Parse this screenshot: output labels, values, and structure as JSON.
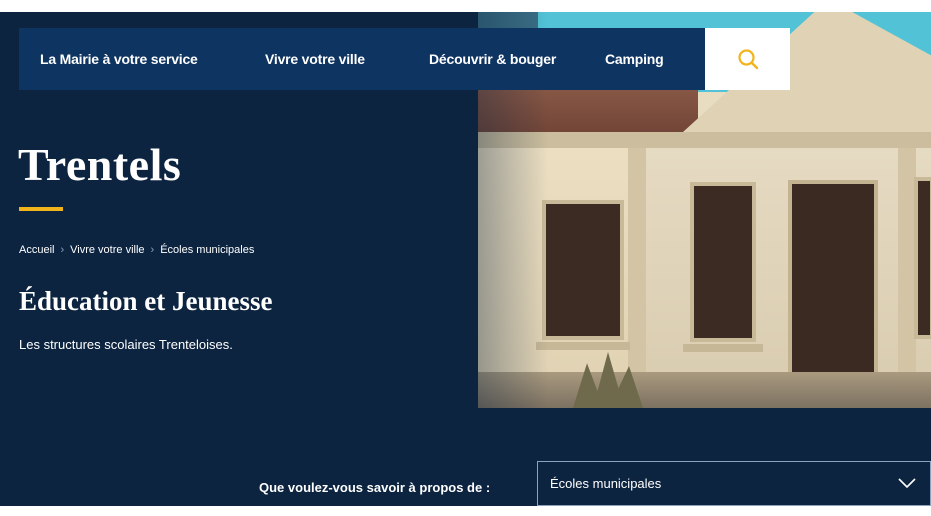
{
  "nav": {
    "items": [
      {
        "label": "La Mairie à votre service"
      },
      {
        "label": "Vivre votre ville"
      },
      {
        "label": "Découvrir & bouger"
      },
      {
        "label": "Camping"
      }
    ],
    "search_icon": "search-icon"
  },
  "hero": {
    "title": "Trentels",
    "breadcrumb": [
      "Accueil",
      "Vivre votre ville",
      "Écoles municipales"
    ],
    "subtitle": "Éducation et Jeunesse",
    "tagline": "Les structures scolaires Trenteloises."
  },
  "topic": {
    "label": "Que voulez-vous savoir à propos de :",
    "selected": "Écoles municipales"
  },
  "colors": {
    "navy": "#0c2440",
    "nav_bar": "#0e3461",
    "accent": "#f2b41b"
  }
}
